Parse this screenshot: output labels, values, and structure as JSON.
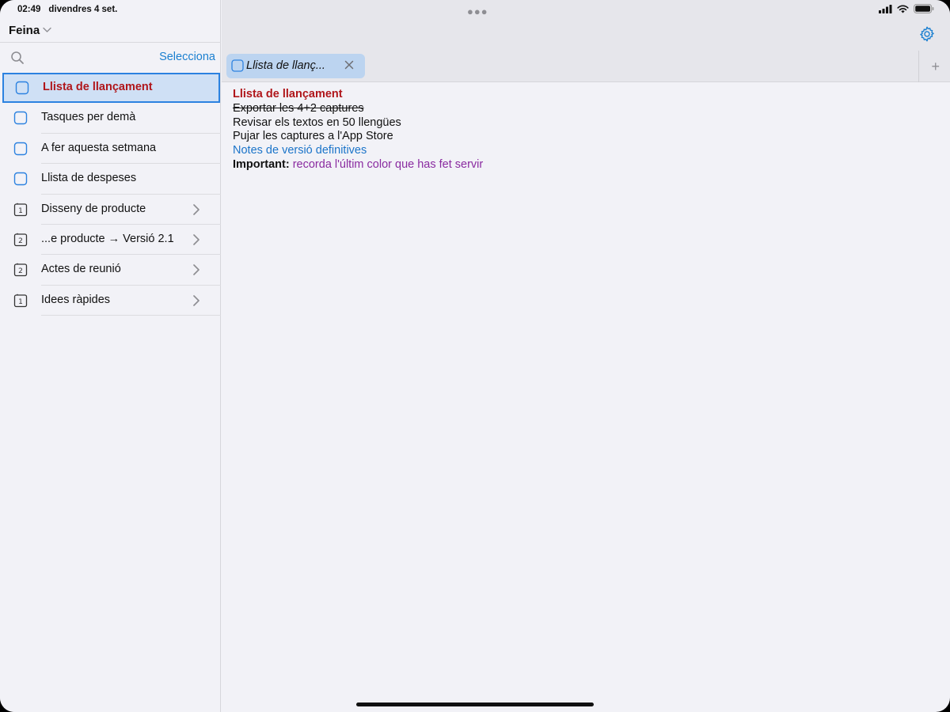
{
  "status": {
    "time": "02:49",
    "date": "divendres 4 set."
  },
  "sidebar": {
    "folder": "Feina",
    "select_label": "Selecciona",
    "items": [
      {
        "label": "Llista de llançament",
        "icon": "checklist-icon",
        "selected": true
      },
      {
        "label": "Tasques per demà",
        "icon": "checklist-icon"
      },
      {
        "label": "A fer aquesta setmana",
        "icon": "checklist-icon"
      },
      {
        "label": "Llista de despeses",
        "icon": "checklist-icon"
      },
      {
        "label": "Disseny de producte",
        "icon": "folder-badge-icon",
        "badge": "1"
      },
      {
        "label": "...e producte → Versió 2.1",
        "icon": "folder-badge-icon",
        "badge": "2"
      },
      {
        "label": "Actes de reunió",
        "icon": "folder-badge-icon",
        "badge": "2"
      },
      {
        "label": "Idees ràpides",
        "icon": "folder-badge-icon",
        "badge": "1"
      }
    ]
  },
  "tab": {
    "label": "Llista de llanç..."
  },
  "doc": {
    "title": "Llista de llançament",
    "line1": "Exportar les 4+2 captures",
    "line2": "Revisar els textos en 50 llengües",
    "line3": "Pujar les captures a l'App Store",
    "line4": "Notes de versió definitives",
    "line5_bold": "Important:",
    "line5_rest": "recorda l'últim color que has fet servir"
  },
  "colors": {
    "accent": "#1a7fd0",
    "title_red": "#b0161b",
    "selected_bg": "#cfe0f5",
    "purple": "#8a2ba0"
  }
}
